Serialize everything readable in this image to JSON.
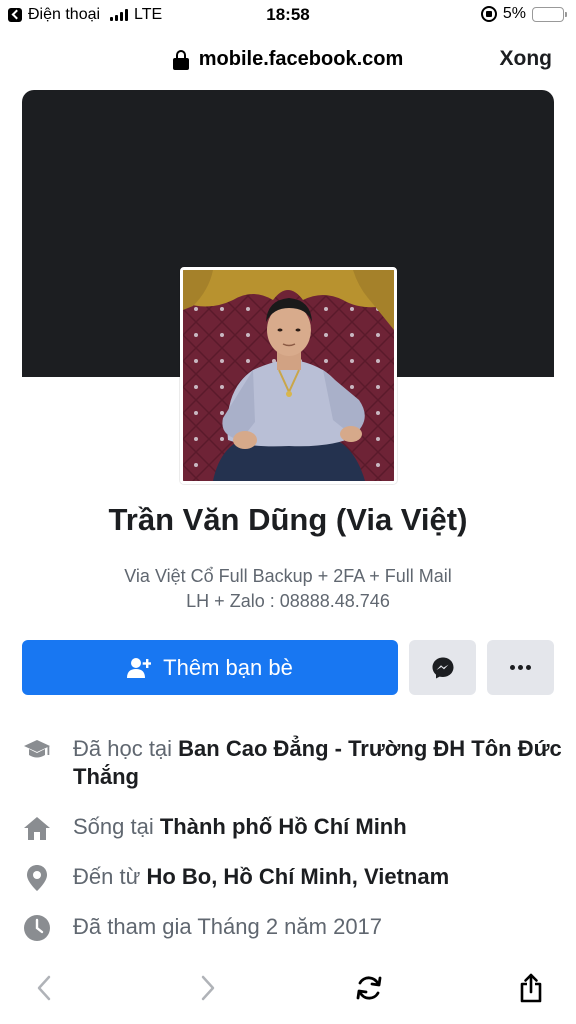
{
  "status_bar": {
    "back_app": "Điện thoại",
    "network": "LTE",
    "time": "18:58",
    "battery": "5%",
    "battery_level": 0.05
  },
  "browser": {
    "url": "mobile.facebook.com",
    "done_label": "Xong"
  },
  "profile": {
    "name": "Trần Văn Dũng (Via Việt)",
    "bio_line1": "Via Việt Cổ Full Backup + 2FA + Full Mail",
    "bio_line2": "LH + Zalo : 08888.48.746",
    "add_friend_label": "Thêm bạn bè"
  },
  "info": {
    "education_prefix": "Đã học tại ",
    "education_value": "Ban Cao Đẳng - Trường ĐH Tôn Đức Thắng",
    "lives_prefix": "Sống tại ",
    "lives_value": "Thành phố Hồ Chí Minh",
    "from_prefix": "Đến từ ",
    "from_value": "Ho Bo, Hồ Chí Minh, Vietnam",
    "joined": "Đã tham gia Tháng 2 năm 2017"
  },
  "icons": {
    "education": "graduation-cap-icon",
    "lives": "home-icon",
    "from": "location-pin-icon",
    "joined": "clock-icon",
    "messenger": "messenger-icon",
    "more": "more-dots-icon"
  },
  "colors": {
    "primary": "#1877f2",
    "cover": "#1c1e21",
    "button_secondary": "#e4e6eb",
    "secondary_text": "#606770"
  }
}
